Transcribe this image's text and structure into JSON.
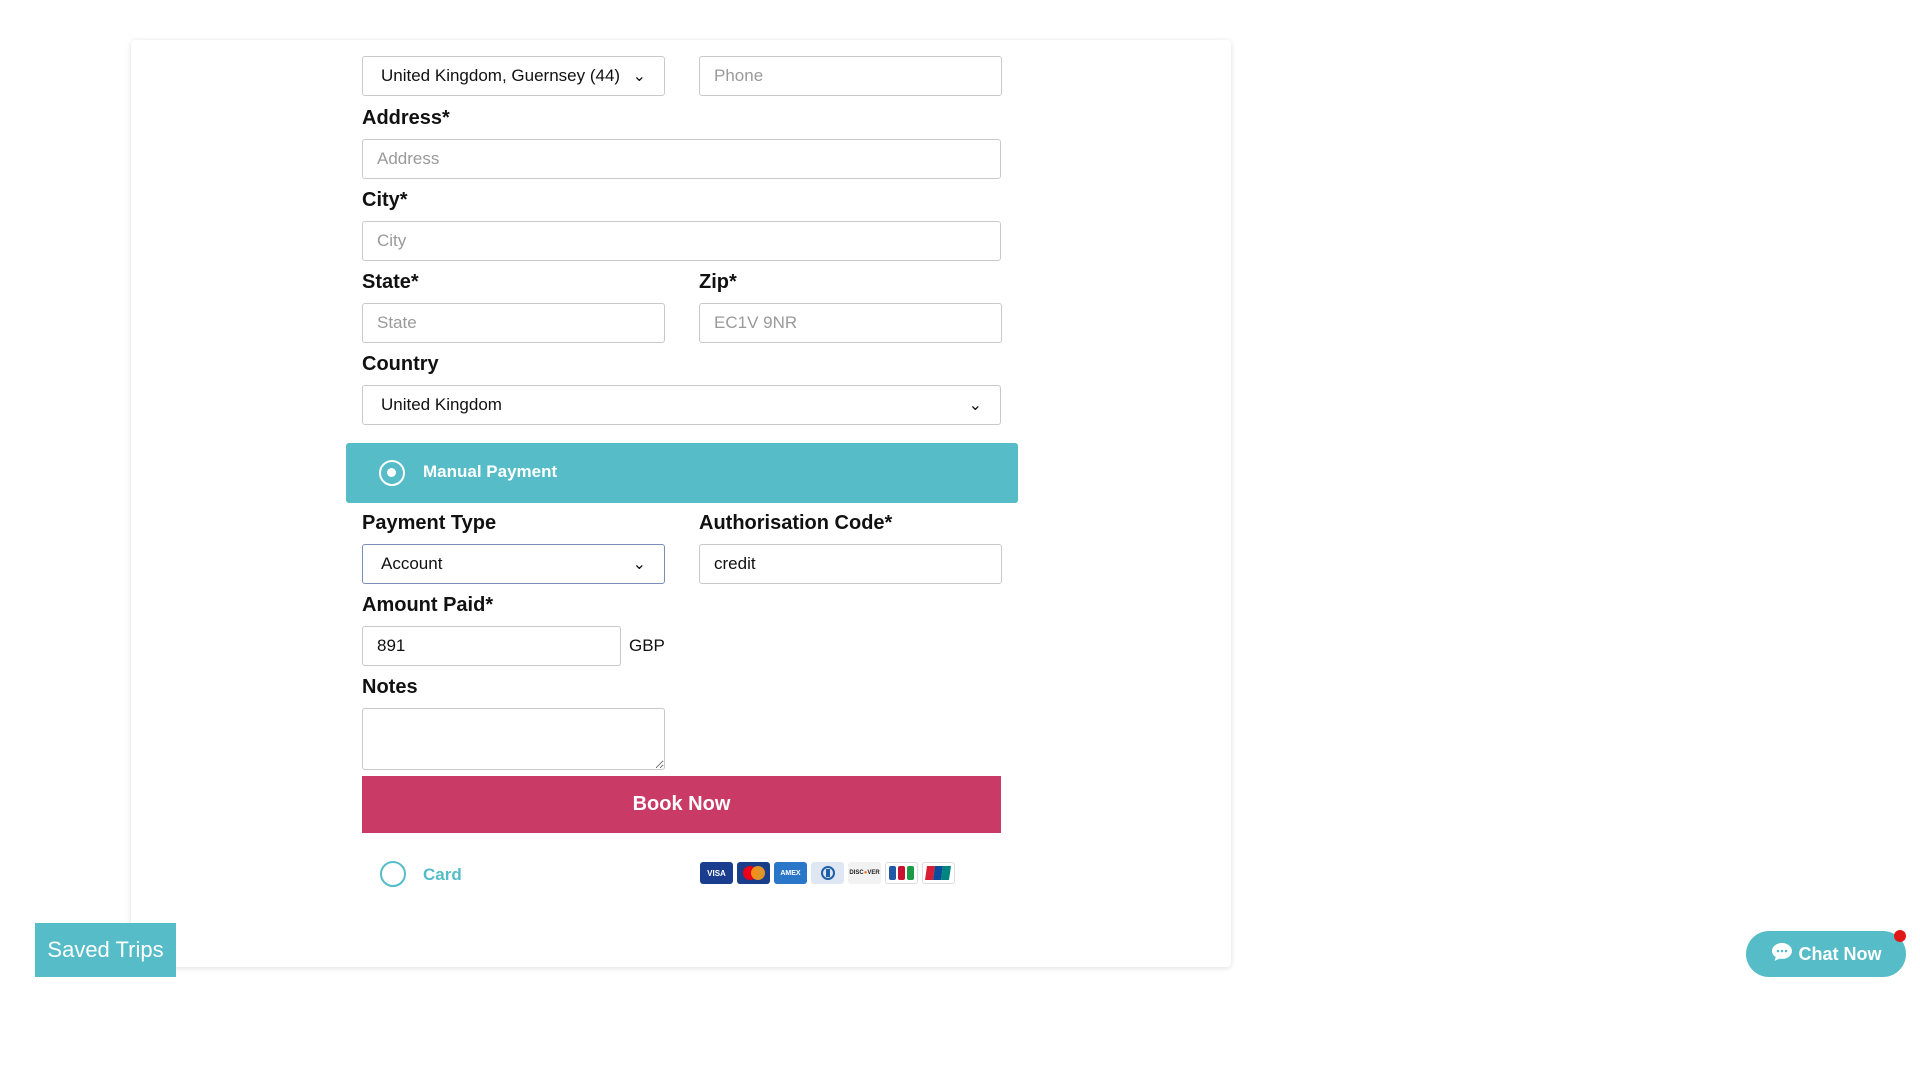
{
  "billing": {
    "phone_code_value": "United Kingdom, Guernsey (44)",
    "phone_placeholder": "Phone",
    "address_label": "Address*",
    "address_placeholder": "Address",
    "city_label": "City*",
    "city_placeholder": "City",
    "state_label": "State*",
    "state_placeholder": "State",
    "zip_label": "Zip*",
    "zip_placeholder": "EC1V 9NR",
    "country_label": "Country",
    "country_value": "United Kingdom"
  },
  "manual_payment": {
    "label": "Manual Payment",
    "selected": true,
    "payment_type_label": "Payment Type",
    "payment_type_value": "Account",
    "auth_code_label": "Authorisation Code*",
    "auth_code_value": "credit",
    "amount_label": "Amount Paid*",
    "amount_value": "891",
    "currency": "GBP",
    "notes_label": "Notes",
    "notes_value": ""
  },
  "book_button_label": "Book Now",
  "card_option": {
    "label": "Card",
    "selected": false,
    "icons": [
      "visa-icon",
      "mastercard-icon",
      "amex-icon",
      "diners-club-icon",
      "discover-icon",
      "jcb-icon",
      "unionpay-icon"
    ]
  },
  "saved_trips_label": "Saved Trips",
  "chat_now_label": "Chat Now",
  "colors": {
    "accent": "#55bcc8",
    "primary_button": "#c93a66",
    "notification_dot": "#e01818"
  }
}
